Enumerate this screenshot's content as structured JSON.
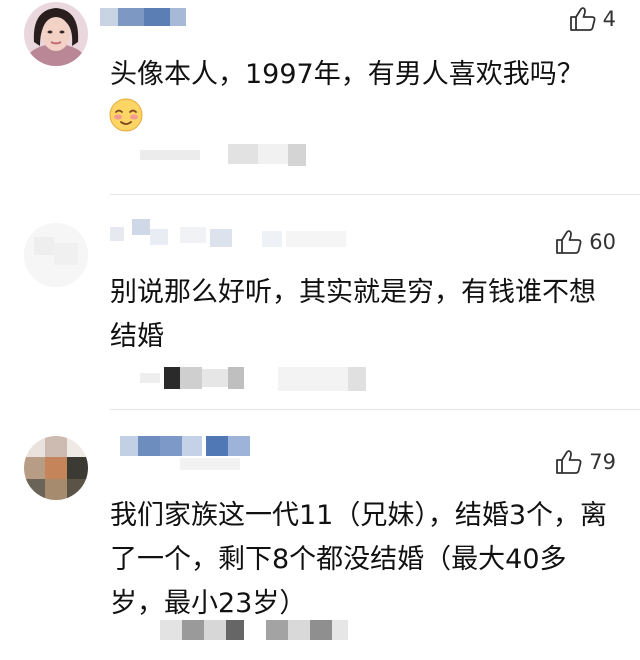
{
  "comments": [
    {
      "likes": "4",
      "text": "头像本人，1997年，有男人喜欢我吗？",
      "emoji": "blush-face"
    },
    {
      "likes": "60",
      "text": "别说那么好听，其实就是穷，有钱谁不想结婚"
    },
    {
      "likes": "79",
      "text": "我们家族这一代11（兄妹），结婚3个，离了一个，剩下8个都没结婚（最大40多岁，最小23岁）"
    }
  ],
  "icons": {
    "like": "thumbs-up-icon"
  },
  "colors": {
    "name_blur": "#5b7fb5",
    "text": "#111111",
    "meta_blur": "#d9d9d9"
  }
}
